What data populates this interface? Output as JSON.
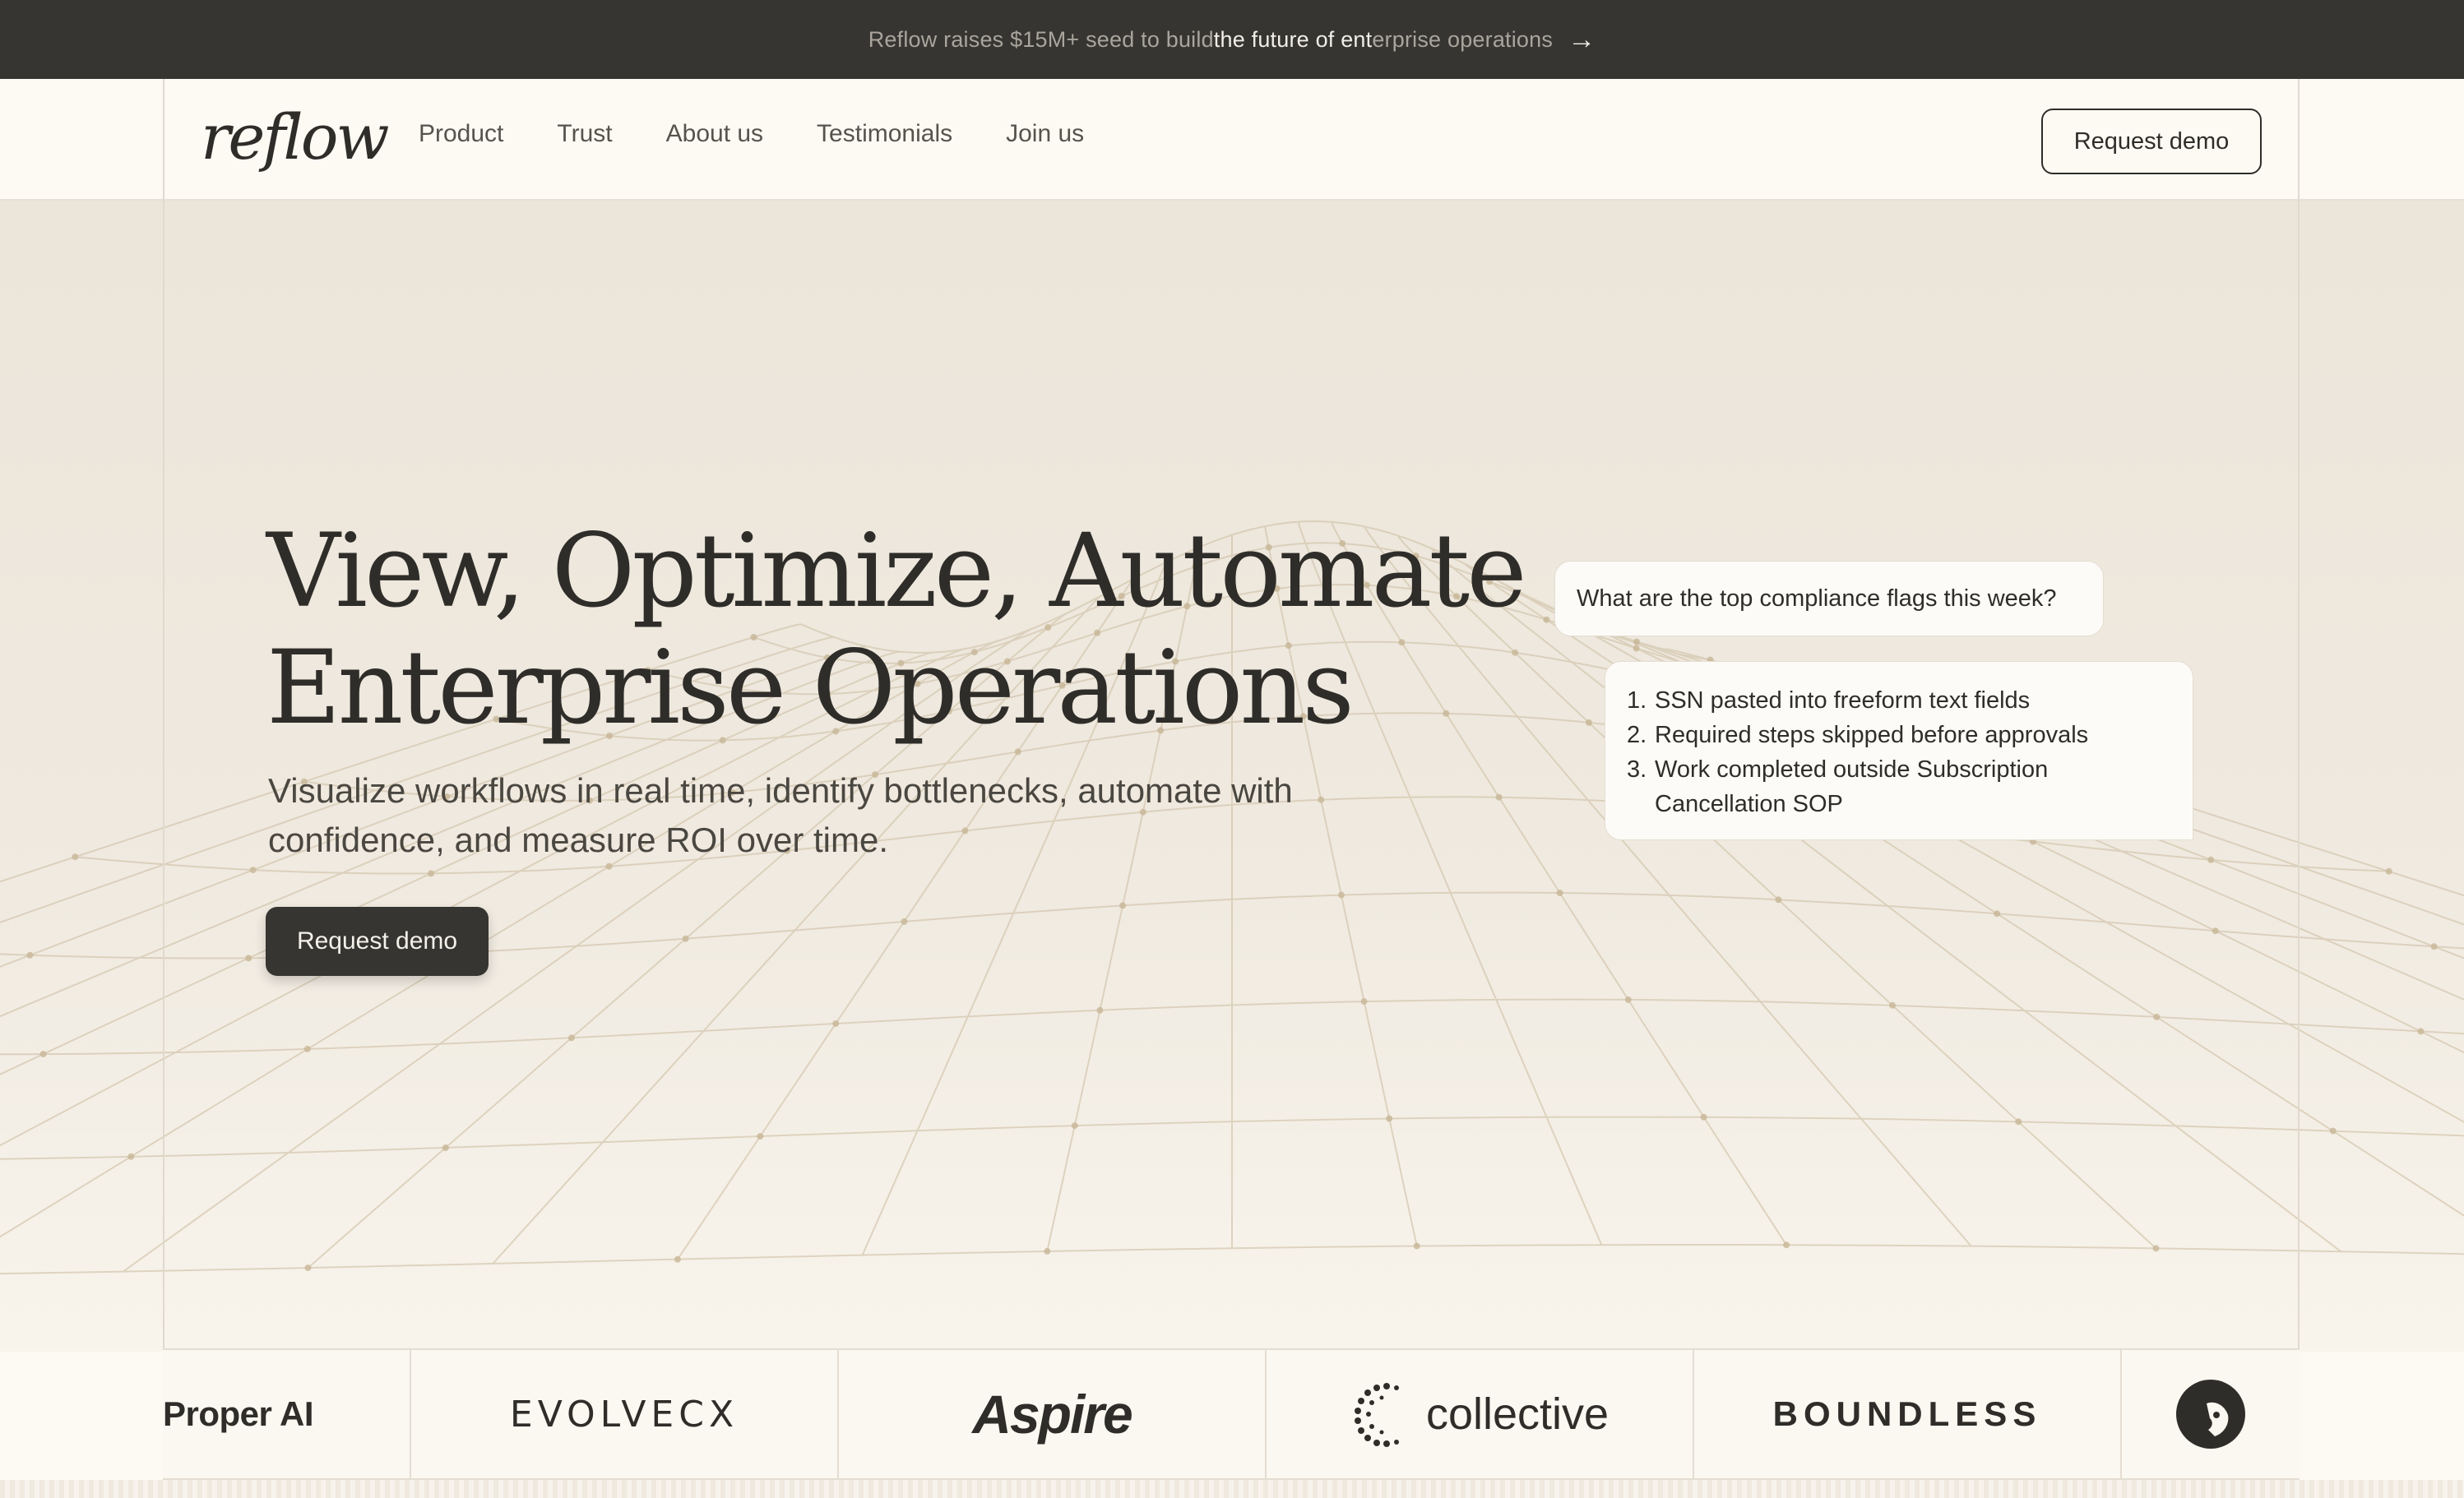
{
  "announcement": {
    "pre": "Reflow raises $15M+ seed to build ",
    "highlight": "the future of ent",
    "post": "erprise operations",
    "arrow": "→"
  },
  "header": {
    "logo": "reflow",
    "nav": [
      "Product",
      "Trust",
      "About us",
      "Testimonials",
      "Join us"
    ],
    "cta": "Request demo"
  },
  "hero": {
    "title_line1": "View, Optimize, Automate",
    "title_line2": "Enterprise Operations",
    "subtitle_line1": "Visualize workflows in real time, identify bottlenecks, automate with",
    "subtitle_line2": "confidence, and measure ROI over time.",
    "cta": "Request demo"
  },
  "chat": {
    "question": "What are the top compliance flags this week?",
    "answers": [
      {
        "num": "1.",
        "text": "SSN pasted into freeform text fields"
      },
      {
        "num": "2.",
        "text": "Required steps skipped before approvals"
      },
      {
        "num": "3.",
        "text": "Work completed outside Subscription Cancellation SOP"
      }
    ]
  },
  "logos": {
    "proper": "Proper AI",
    "evolve": "EVOLVECX",
    "aspire": "Aspire",
    "collective": "collective",
    "boundless": "BOUNDLESS"
  },
  "icons": {
    "announcement_arrow": "arrow-right-icon",
    "collective_mark": "dotted-c-icon",
    "last_logo": "dog-circle-icon"
  },
  "colors": {
    "dark": "#363531",
    "cream": "#fdfaf3",
    "hero_bg": "#ebe5da",
    "text": "#2f2d29"
  }
}
